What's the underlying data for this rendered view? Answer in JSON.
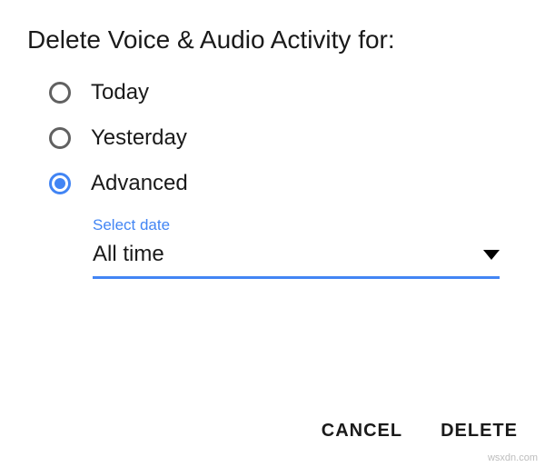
{
  "dialog": {
    "title": "Delete Voice & Audio Activity for:",
    "options": {
      "today": "Today",
      "yesterday": "Yesterday",
      "advanced": "Advanced"
    },
    "select": {
      "label": "Select date",
      "value": "All time"
    },
    "buttons": {
      "cancel": "CANCEL",
      "delete": "DELETE"
    }
  },
  "watermark": "wsxdn.com"
}
